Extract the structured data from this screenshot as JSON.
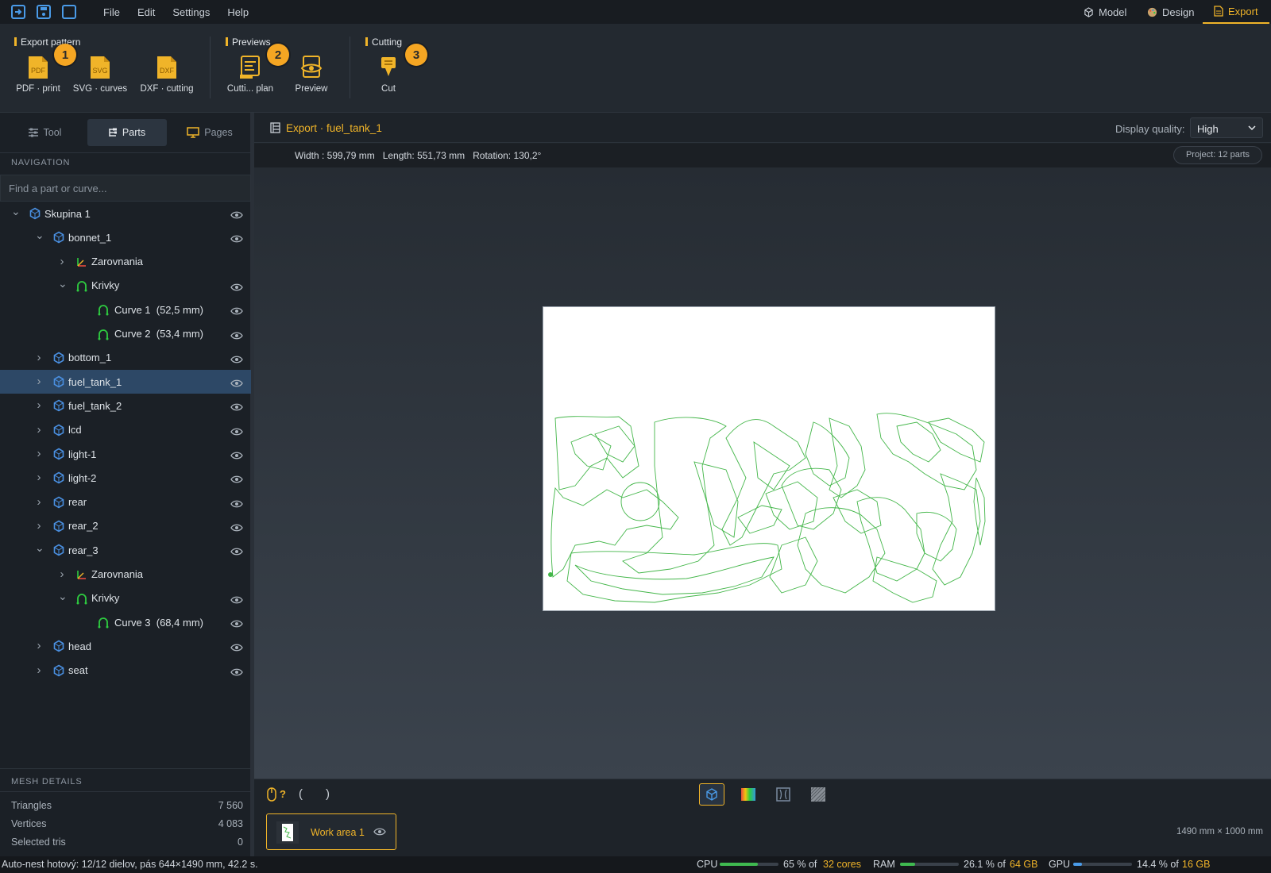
{
  "menubar": {
    "items": [
      "File",
      "Edit",
      "Settings",
      "Help"
    ],
    "modes": [
      {
        "label": "Model",
        "icon": "cube-icon"
      },
      {
        "label": "Design",
        "icon": "palette-icon"
      },
      {
        "label": "Export",
        "icon": "document-icon",
        "active": true
      }
    ]
  },
  "ribbon": {
    "groups": [
      {
        "title": "Export pattern",
        "badge": "1",
        "buttons": [
          {
            "label": "PDF · print",
            "icon": "pdf-file-icon",
            "tag": "PDF"
          },
          {
            "label": "SVG · curves",
            "icon": "svg-file-icon",
            "tag": "SVG"
          },
          {
            "label": "DXF · cutting",
            "icon": "dxf-file-icon",
            "tag": "DXF"
          }
        ]
      },
      {
        "title": "Previews",
        "badge": "2",
        "buttons": [
          {
            "label": "Cutti... plan",
            "icon": "cutting-plan-icon"
          },
          {
            "label": "Preview",
            "icon": "eye-preview-icon"
          }
        ]
      },
      {
        "title": "Cutting",
        "badge": "3",
        "buttons": [
          {
            "label": "Cut",
            "icon": "cutter-icon"
          }
        ]
      }
    ]
  },
  "leftpanel": {
    "tabs": [
      {
        "label": "Tool",
        "icon": "sliders-icon"
      },
      {
        "label": "Parts",
        "icon": "parts-icon",
        "active": true
      },
      {
        "label": "Pages",
        "icon": "pages-icon"
      }
    ],
    "nav_header": "NAVIGATION",
    "search_placeholder": "Find a part or curve...",
    "tree": [
      {
        "label": "Skupina 1",
        "level": 0,
        "expanded": true,
        "type": "part",
        "eye": true
      },
      {
        "label": "bonnet_1",
        "level": 1,
        "expanded": true,
        "type": "part",
        "eye": true
      },
      {
        "label": "Zarovnania",
        "level": 2,
        "expanded": false,
        "type": "axes",
        "eye": false
      },
      {
        "label": "Krivky",
        "level": 2,
        "expanded": true,
        "type": "curve",
        "eye": true
      },
      {
        "label": "Curve 1  (52,5 mm)",
        "level": 3,
        "type": "curve",
        "eye": true
      },
      {
        "label": "Curve 2  (53,4 mm)",
        "level": 3,
        "type": "curve",
        "eye": true
      },
      {
        "label": "bottom_1",
        "level": 1,
        "expanded": false,
        "type": "part",
        "eye": true
      },
      {
        "label": "fuel_tank_1",
        "level": 1,
        "expanded": false,
        "type": "part",
        "eye": true,
        "selected": true
      },
      {
        "label": "fuel_tank_2",
        "level": 1,
        "expanded": false,
        "type": "part",
        "eye": true
      },
      {
        "label": "lcd",
        "level": 1,
        "expanded": false,
        "type": "part",
        "eye": true
      },
      {
        "label": "light-1",
        "level": 1,
        "expanded": false,
        "type": "part",
        "eye": true
      },
      {
        "label": "light-2",
        "level": 1,
        "expanded": false,
        "type": "part",
        "eye": true
      },
      {
        "label": "rear",
        "level": 1,
        "expanded": false,
        "type": "part",
        "eye": true
      },
      {
        "label": "rear_2",
        "level": 1,
        "expanded": false,
        "type": "part",
        "eye": true
      },
      {
        "label": "rear_3",
        "level": 1,
        "expanded": true,
        "type": "part",
        "eye": true
      },
      {
        "label": "Zarovnania",
        "level": 2,
        "expanded": false,
        "type": "axes",
        "eye": false
      },
      {
        "label": "Krivky",
        "level": 2,
        "expanded": true,
        "type": "curve",
        "eye": true
      },
      {
        "label": "Curve 3  (68,4 mm)",
        "level": 3,
        "type": "curve",
        "eye": true
      },
      {
        "label": "head",
        "level": 1,
        "expanded": false,
        "type": "part",
        "eye": true
      },
      {
        "label": "seat",
        "level": 1,
        "expanded": false,
        "type": "part",
        "eye": true
      }
    ],
    "mesh_header": "MESH DETAILS",
    "mesh": [
      {
        "label": "Triangles",
        "value": "7 560"
      },
      {
        "label": "Vertices",
        "value": "4 083"
      },
      {
        "label": "Selected tris",
        "value": "0"
      }
    ]
  },
  "main": {
    "title": "Export · fuel_tank_1",
    "quality_label": "Display quality:",
    "quality_value": "High",
    "info": "Width : 599,79 mm   Length: 551,73 mm   Rotation: 130,2°",
    "project_badge": "Project: 12 parts"
  },
  "viewtools": {
    "mouse_hint": "?",
    "bracket_left": "(",
    "bracket_right": ")"
  },
  "workbar": {
    "work_area_label": "Work area 1",
    "dimensions": "1490 mm × 1000 mm"
  },
  "statusbar": {
    "message": "Auto-nest hotový: 12/12 dielov, pás 644×1490 mm, 42.2 s.",
    "cpu_label": "CPU",
    "cpu_pct": 0.65,
    "cpu_text": "65 % of",
    "cpu_total": "32 cores",
    "ram_label": "RAM",
    "ram_pct": 0.261,
    "ram_text": "26.1 % of",
    "ram_total": "64 GB",
    "gpu_label": "GPU",
    "gpu_pct": 0.144,
    "gpu_text": "14.4 % of",
    "gpu_total": "16 GB"
  },
  "colors": {
    "accent": "#f0b429",
    "selection": "#2d4866",
    "part_icon": "#4a90e2",
    "curve_icon": "#2ecc40",
    "cut_line": "#43b649"
  }
}
